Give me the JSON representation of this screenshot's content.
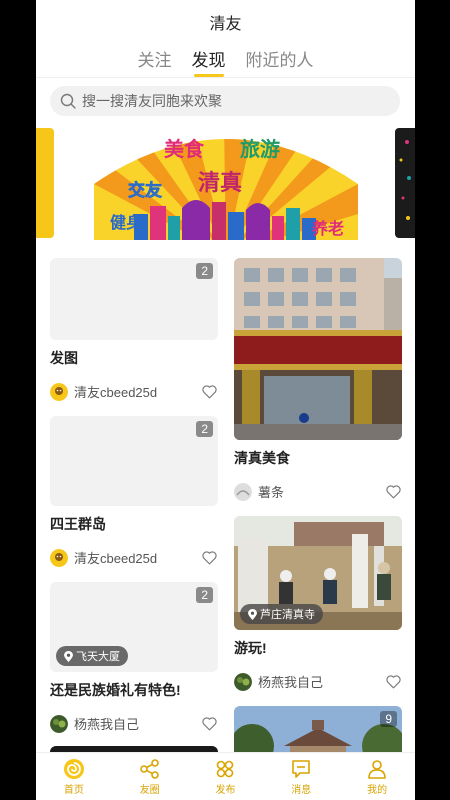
{
  "header": {
    "title": "清友"
  },
  "tabs": [
    {
      "label": "关注"
    },
    {
      "label": "发现"
    },
    {
      "label": "附近的人"
    }
  ],
  "search": {
    "placeholder": "搜一搜清友同胞来欢聚"
  },
  "banner": {
    "words": [
      "美食",
      "旅游",
      "交友",
      "清真",
      "健身",
      "养老"
    ]
  },
  "feed": {
    "left": [
      {
        "title": "发图",
        "image_count": "2",
        "user": "清友cbeed25d"
      },
      {
        "title": "四王群岛",
        "image_count": "2",
        "user": "清友cbeed25d"
      },
      {
        "title": "还是民族婚礼有特色!",
        "image_count": "2",
        "location": "飞天大厦",
        "user": "杨燕我自己"
      }
    ],
    "right": [
      {
        "title": "清真美食",
        "user": "薯条"
      },
      {
        "title": "游玩!",
        "location": "芦庄清真寺",
        "user": "杨燕我自己"
      },
      {
        "image_count": "9"
      }
    ]
  },
  "nav": [
    {
      "label": "首页",
      "icon": "home-swirl-icon"
    },
    {
      "label": "友圈",
      "icon": "share-icon"
    },
    {
      "label": "发布",
      "icon": "publish-icon"
    },
    {
      "label": "消息",
      "icon": "message-icon"
    },
    {
      "label": "我的",
      "icon": "profile-icon"
    }
  ],
  "colors": {
    "accent": "#f6c619",
    "nav_label": "#d9a400"
  }
}
